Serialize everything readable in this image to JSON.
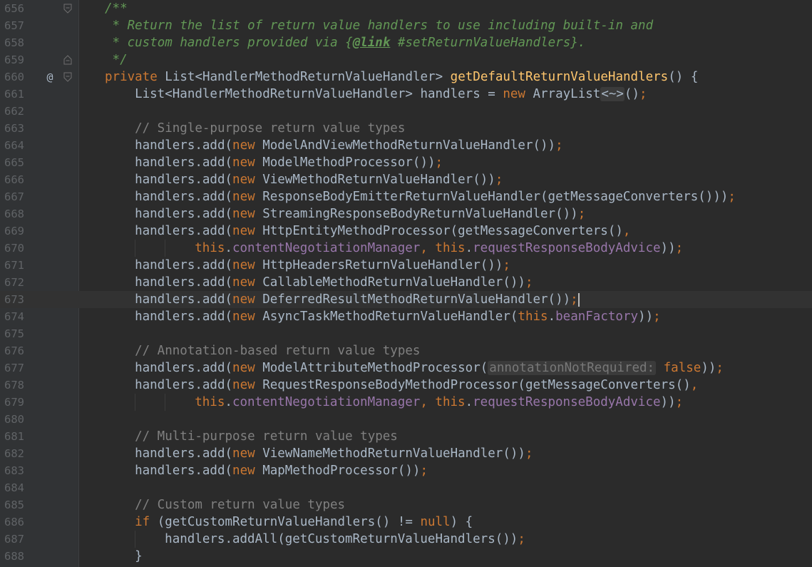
{
  "editor": {
    "lines": [
      {
        "n": "656",
        "marker": "",
        "fold": "start",
        "indent": 0,
        "tokens": [
          {
            "t": "/**",
            "c": "doc"
          }
        ]
      },
      {
        "n": "657",
        "marker": "",
        "fold": "",
        "indent": 0,
        "tokens": [
          {
            "t": " * Return the list of return value handlers to use including built-in and",
            "c": "doc"
          }
        ]
      },
      {
        "n": "658",
        "marker": "",
        "fold": "",
        "indent": 0,
        "tokens": [
          {
            "t": " * custom handlers provided via {",
            "c": "doc"
          },
          {
            "t": "@link",
            "c": "doctag"
          },
          {
            "t": " #setReturnValueHandlers}.",
            "c": "doc"
          }
        ]
      },
      {
        "n": "659",
        "marker": "",
        "fold": "end",
        "indent": 0,
        "tokens": [
          {
            "t": " */",
            "c": "doc"
          }
        ]
      },
      {
        "n": "660",
        "marker": "@",
        "fold": "start",
        "indent": 0,
        "tokens": [
          {
            "t": "private",
            "c": "kw"
          },
          {
            "t": " List<HandlerMethodReturnValueHandler> ",
            "c": "plain"
          },
          {
            "t": "getDefaultReturnValueHandlers",
            "c": "fn"
          },
          {
            "t": "() {",
            "c": "plain"
          }
        ]
      },
      {
        "n": "661",
        "marker": "",
        "fold": "",
        "indent": 1,
        "tokens": [
          {
            "t": "List<HandlerMethodReturnValueHandler> handlers = ",
            "c": "plain"
          },
          {
            "t": "new",
            "c": "kw"
          },
          {
            "t": " ArrayList",
            "c": "plain"
          },
          {
            "t": "<~>",
            "c": "diamond"
          },
          {
            "t": "()",
            "c": "plain"
          },
          {
            "t": ";",
            "c": "kw"
          }
        ]
      },
      {
        "n": "662",
        "marker": "",
        "fold": "",
        "indent": 1,
        "tokens": []
      },
      {
        "n": "663",
        "marker": "",
        "fold": "",
        "indent": 1,
        "tokens": [
          {
            "t": "// Single-purpose return value types",
            "c": "comment"
          }
        ]
      },
      {
        "n": "664",
        "marker": "",
        "fold": "",
        "indent": 1,
        "tokens": [
          {
            "t": "handlers.add(",
            "c": "plain"
          },
          {
            "t": "new",
            "c": "kw"
          },
          {
            "t": " ModelAndViewMethodReturnValueHandler())",
            "c": "plain"
          },
          {
            "t": ";",
            "c": "kw"
          }
        ]
      },
      {
        "n": "665",
        "marker": "",
        "fold": "",
        "indent": 1,
        "tokens": [
          {
            "t": "handlers.add(",
            "c": "plain"
          },
          {
            "t": "new",
            "c": "kw"
          },
          {
            "t": " ModelMethodProcessor())",
            "c": "plain"
          },
          {
            "t": ";",
            "c": "kw"
          }
        ]
      },
      {
        "n": "666",
        "marker": "",
        "fold": "",
        "indent": 1,
        "tokens": [
          {
            "t": "handlers.add(",
            "c": "plain"
          },
          {
            "t": "new",
            "c": "kw"
          },
          {
            "t": " ViewMethodReturnValueHandler())",
            "c": "plain"
          },
          {
            "t": ";",
            "c": "kw"
          }
        ]
      },
      {
        "n": "667",
        "marker": "",
        "fold": "",
        "indent": 1,
        "tokens": [
          {
            "t": "handlers.add(",
            "c": "plain"
          },
          {
            "t": "new",
            "c": "kw"
          },
          {
            "t": " ResponseBodyEmitterReturnValueHandler(getMessageConverters()))",
            "c": "plain"
          },
          {
            "t": ";",
            "c": "kw"
          }
        ]
      },
      {
        "n": "668",
        "marker": "",
        "fold": "",
        "indent": 1,
        "tokens": [
          {
            "t": "handlers.add(",
            "c": "plain"
          },
          {
            "t": "new",
            "c": "kw"
          },
          {
            "t": " StreamingResponseBodyReturnValueHandler())",
            "c": "plain"
          },
          {
            "t": ";",
            "c": "kw"
          }
        ]
      },
      {
        "n": "669",
        "marker": "",
        "fold": "",
        "indent": 1,
        "tokens": [
          {
            "t": "handlers.add(",
            "c": "plain"
          },
          {
            "t": "new",
            "c": "kw"
          },
          {
            "t": " HttpEntityMethodProcessor(getMessageConverters()",
            "c": "plain"
          },
          {
            "t": ",",
            "c": "kw"
          }
        ]
      },
      {
        "n": "670",
        "marker": "",
        "fold": "",
        "indent": 3,
        "tokens": [
          {
            "t": "this",
            "c": "kw"
          },
          {
            "t": ".",
            "c": "plain"
          },
          {
            "t": "contentNegotiationManager",
            "c": "field"
          },
          {
            "t": ", ",
            "c": "kw"
          },
          {
            "t": "this",
            "c": "kw"
          },
          {
            "t": ".",
            "c": "plain"
          },
          {
            "t": "requestResponseBodyAdvice",
            "c": "field"
          },
          {
            "t": "))",
            "c": "plain"
          },
          {
            "t": ";",
            "c": "kw"
          }
        ]
      },
      {
        "n": "671",
        "marker": "",
        "fold": "",
        "indent": 1,
        "tokens": [
          {
            "t": "handlers.add(",
            "c": "plain"
          },
          {
            "t": "new",
            "c": "kw"
          },
          {
            "t": " HttpHeadersReturnValueHandler())",
            "c": "plain"
          },
          {
            "t": ";",
            "c": "kw"
          }
        ]
      },
      {
        "n": "672",
        "marker": "",
        "fold": "",
        "indent": 1,
        "tokens": [
          {
            "t": "handlers.add(",
            "c": "plain"
          },
          {
            "t": "new",
            "c": "kw"
          },
          {
            "t": " CallableMethodReturnValueHandler())",
            "c": "plain"
          },
          {
            "t": ";",
            "c": "kw"
          }
        ]
      },
      {
        "n": "673",
        "marker": "",
        "fold": "",
        "indent": 1,
        "current": true,
        "caret": true,
        "tokens": [
          {
            "t": "handlers.add(",
            "c": "plain"
          },
          {
            "t": "new",
            "c": "kw"
          },
          {
            "t": " DeferredResultMethodReturnValueHandler())",
            "c": "plain"
          },
          {
            "t": ";",
            "c": "kw"
          }
        ]
      },
      {
        "n": "674",
        "marker": "",
        "fold": "",
        "indent": 1,
        "tokens": [
          {
            "t": "handlers.add(",
            "c": "plain"
          },
          {
            "t": "new",
            "c": "kw"
          },
          {
            "t": " AsyncTaskMethodReturnValueHandler(",
            "c": "plain"
          },
          {
            "t": "this",
            "c": "kw"
          },
          {
            "t": ".",
            "c": "plain"
          },
          {
            "t": "beanFactory",
            "c": "field"
          },
          {
            "t": "))",
            "c": "plain"
          },
          {
            "t": ";",
            "c": "kw"
          }
        ]
      },
      {
        "n": "675",
        "marker": "",
        "fold": "",
        "indent": 1,
        "tokens": []
      },
      {
        "n": "676",
        "marker": "",
        "fold": "",
        "indent": 1,
        "tokens": [
          {
            "t": "// Annotation-based return value types",
            "c": "comment"
          }
        ]
      },
      {
        "n": "677",
        "marker": "",
        "fold": "",
        "indent": 1,
        "tokens": [
          {
            "t": "handlers.add(",
            "c": "plain"
          },
          {
            "t": "new",
            "c": "kw"
          },
          {
            "t": " ModelAttributeMethodProcessor(",
            "c": "plain"
          },
          {
            "t": "annotationNotRequired:",
            "c": "hint"
          },
          {
            "t": " ",
            "c": "plain"
          },
          {
            "t": "false",
            "c": "kw"
          },
          {
            "t": "))",
            "c": "plain"
          },
          {
            "t": ";",
            "c": "kw"
          }
        ]
      },
      {
        "n": "678",
        "marker": "",
        "fold": "",
        "indent": 1,
        "tokens": [
          {
            "t": "handlers.add(",
            "c": "plain"
          },
          {
            "t": "new",
            "c": "kw"
          },
          {
            "t": " RequestResponseBodyMethodProcessor(getMessageConverters()",
            "c": "plain"
          },
          {
            "t": ",",
            "c": "kw"
          }
        ]
      },
      {
        "n": "679",
        "marker": "",
        "fold": "",
        "indent": 3,
        "tokens": [
          {
            "t": "this",
            "c": "kw"
          },
          {
            "t": ".",
            "c": "plain"
          },
          {
            "t": "contentNegotiationManager",
            "c": "field"
          },
          {
            "t": ", ",
            "c": "kw"
          },
          {
            "t": "this",
            "c": "kw"
          },
          {
            "t": ".",
            "c": "plain"
          },
          {
            "t": "requestResponseBodyAdvice",
            "c": "field"
          },
          {
            "t": "))",
            "c": "plain"
          },
          {
            "t": ";",
            "c": "kw"
          }
        ]
      },
      {
        "n": "680",
        "marker": "",
        "fold": "",
        "indent": 1,
        "tokens": []
      },
      {
        "n": "681",
        "marker": "",
        "fold": "",
        "indent": 1,
        "tokens": [
          {
            "t": "// Multi-purpose return value types",
            "c": "comment"
          }
        ]
      },
      {
        "n": "682",
        "marker": "",
        "fold": "",
        "indent": 1,
        "tokens": [
          {
            "t": "handlers.add(",
            "c": "plain"
          },
          {
            "t": "new",
            "c": "kw"
          },
          {
            "t": " ViewNameMethodReturnValueHandler())",
            "c": "plain"
          },
          {
            "t": ";",
            "c": "kw"
          }
        ]
      },
      {
        "n": "683",
        "marker": "",
        "fold": "",
        "indent": 1,
        "tokens": [
          {
            "t": "handlers.add(",
            "c": "plain"
          },
          {
            "t": "new",
            "c": "kw"
          },
          {
            "t": " MapMethodProcessor())",
            "c": "plain"
          },
          {
            "t": ";",
            "c": "kw"
          }
        ]
      },
      {
        "n": "684",
        "marker": "",
        "fold": "",
        "indent": 1,
        "tokens": []
      },
      {
        "n": "685",
        "marker": "",
        "fold": "",
        "indent": 1,
        "tokens": [
          {
            "t": "// Custom return value types",
            "c": "comment"
          }
        ]
      },
      {
        "n": "686",
        "marker": "",
        "fold": "",
        "indent": 1,
        "tokens": [
          {
            "t": "if",
            "c": "kw"
          },
          {
            "t": " (getCustomReturnValueHandlers() != ",
            "c": "plain"
          },
          {
            "t": "null",
            "c": "kw"
          },
          {
            "t": ") {",
            "c": "plain"
          }
        ]
      },
      {
        "n": "687",
        "marker": "",
        "fold": "",
        "indent": 2,
        "tokens": [
          {
            "t": "handlers.addAll(getCustomReturnValueHandlers())",
            "c": "plain"
          },
          {
            "t": ";",
            "c": "kw"
          }
        ]
      },
      {
        "n": "688",
        "marker": "",
        "fold": "",
        "indent": 1,
        "tokens": [
          {
            "t": "}",
            "c": "plain"
          }
        ]
      }
    ]
  },
  "icons": {
    "override_marker": "override-method-icon",
    "fold_start": "fold-collapse-icon",
    "fold_end": "fold-end-icon"
  },
  "colors": {
    "background": "#2b2b2b",
    "gutter": "#313335",
    "line_number": "#606366",
    "plain": "#a9b7c6",
    "keyword": "#cc7832",
    "method_decl": "#ffc66d",
    "field": "#9876aa",
    "comment": "#808080",
    "doc_comment": "#629755"
  }
}
